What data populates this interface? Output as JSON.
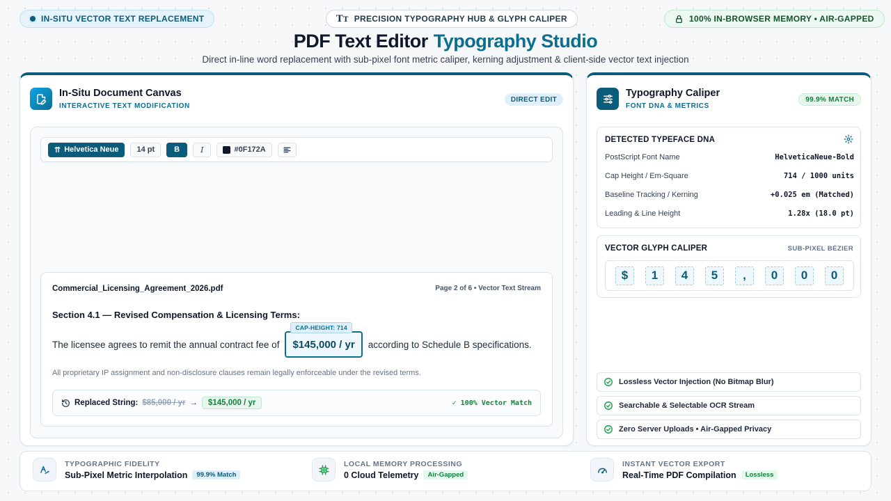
{
  "header": {
    "pill_left": "IN-SITU VECTOR TEXT REPLACEMENT",
    "pill_center": "PRECISION TYPOGRAPHY HUB & GLYPH CALIPER",
    "pill_right": "100% IN-BROWSER MEMORY • AIR-GAPPED",
    "title": "PDF Text Editor",
    "title_accent": "Typography Studio",
    "subtitle": "Direct in-line word replacement with sub-pixel font metric caliper, kerning adjustment & client-side vector text injection"
  },
  "canvas_panel": {
    "title": "In-Situ Document Canvas",
    "subtitle": "INTERACTIVE TEXT MODIFICATION",
    "badge": "DIRECT EDIT",
    "toolbar": {
      "font": "Helvetica Neue",
      "size": "14 pt",
      "bold": "B",
      "italic": "I",
      "color_hex": "#0F172A"
    },
    "document": {
      "filename": "Commercial_Licensing_Agreement_2026.pdf",
      "page_info": "Page 2 of 6 • Vector Text Stream",
      "section": "Section 4.1 — Revised Compensation & Licensing Terms:",
      "line_before": "The licensee agrees to remit the annual contract fee of",
      "edited_value": "$145,000 / yr",
      "cap_tag": "CAP-HEIGHT: 714",
      "line_after": "according to Schedule B specifications.",
      "note": "All proprietary IP assignment and non-disclosure clauses remain legally enforceable under the revised terms.",
      "replaced_label": "Replaced String:",
      "old_value": "$85,000 / yr",
      "arrow": "→",
      "new_value": "$145,000 / yr",
      "match": "✓ 100% Vector Match"
    }
  },
  "caliper_panel": {
    "title": "Typography Caliper",
    "subtitle": "FONT DNA & METRICS",
    "badge": "99.9% MATCH",
    "dna": {
      "title": "DETECTED TYPEFACE DNA",
      "rows": [
        {
          "k": "PostScript Font Name",
          "v": "HelveticaNeue-Bold"
        },
        {
          "k": "Cap Height / Em-Square",
          "v": "714 / 1000 units"
        },
        {
          "k": "Baseline Tracking / Kerning",
          "v": "+0.025 em (Matched)"
        },
        {
          "k": "Leading & Line Height",
          "v": "1.28x (18.0 pt)"
        }
      ]
    },
    "glyph_caliper": {
      "title": "VECTOR GLYPH CALIPER",
      "tag": "SUB-PIXEL BÉZIER",
      "glyphs": [
        "$",
        "1",
        "4",
        "5",
        ",",
        "0",
        "0",
        "0"
      ]
    },
    "features": [
      "Lossless Vector Injection (No Bitmap Blur)",
      "Searchable & Selectable OCR Stream",
      "Zero Server Uploads • Air-Gapped Privacy"
    ]
  },
  "footer": {
    "stats": [
      {
        "label": "TYPOGRAPHIC FIDELITY",
        "value": "Sub-Pixel Metric Interpolation",
        "chip": "99.9% Match"
      },
      {
        "label": "LOCAL MEMORY PROCESSING",
        "value": "0 Cloud Telemetry",
        "chip": "Air-Gapped"
      },
      {
        "label": "INSTANT VECTOR EXPORT",
        "value": "Real-Time PDF Compilation",
        "chip": "Lossless"
      }
    ]
  },
  "colors": {
    "accent": "#0b6e8e",
    "accent_dark": "#0b5b7a",
    "success": "#15803d",
    "text": "#0f172a"
  }
}
